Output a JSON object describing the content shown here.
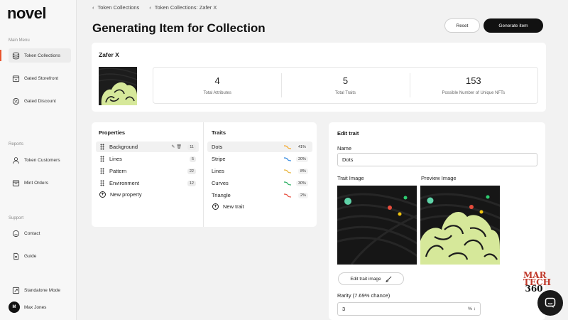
{
  "app": {
    "logo": "novel"
  },
  "sidebar": {
    "main_label": "Main Menu",
    "main_items": [
      {
        "label": "Token Collections",
        "icon": "database-icon",
        "active": true
      },
      {
        "label": "Gated Storefront",
        "icon": "storefront-icon"
      },
      {
        "label": "Gated Discount",
        "icon": "discount-icon"
      }
    ],
    "reports_label": "Reports",
    "reports_items": [
      {
        "label": "Token Customers",
        "icon": "user-icon"
      },
      {
        "label": "Mint Orders",
        "icon": "orders-icon"
      }
    ],
    "support_label": "Support",
    "support_items": [
      {
        "label": "Contact",
        "icon": "contact-icon"
      },
      {
        "label": "Guide",
        "icon": "guide-icon"
      }
    ],
    "standalone_label": "Standalone Mode",
    "user": {
      "initial": "M",
      "name": "Max Jones"
    }
  },
  "breadcrumbs": [
    "Token Collections",
    "Token Collections: Zafer X"
  ],
  "header": {
    "title": "Generating Item for Collection",
    "reset_label": "Reset",
    "generate_label": "Generate item"
  },
  "collection": {
    "name": "Zafer X",
    "stats": [
      {
        "value": "4",
        "label": "Total Attributes"
      },
      {
        "value": "5",
        "label": "Total Traits"
      },
      {
        "value": "153",
        "label": "Possible Number of Unique NFTs"
      }
    ]
  },
  "properties": {
    "title": "Properties",
    "items": [
      {
        "name": "Background",
        "count": "11",
        "selected": true
      },
      {
        "name": "Lines",
        "count": "5"
      },
      {
        "name": "Pattern",
        "count": "22"
      },
      {
        "name": "Environment",
        "count": "12"
      }
    ],
    "add_label": "New property"
  },
  "traits": {
    "title": "Traits",
    "items": [
      {
        "name": "Dots",
        "percent": "41%",
        "color": "#f5a623",
        "selected": true
      },
      {
        "name": "Stripe",
        "percent": "20%",
        "color": "#2e86de"
      },
      {
        "name": "Lines",
        "percent": "8%",
        "color": "#e8b339"
      },
      {
        "name": "Curves",
        "percent": "30%",
        "color": "#27ae60"
      },
      {
        "name": "Triangle",
        "percent": "2%",
        "color": "#e74c3c"
      }
    ],
    "add_label": "New trait"
  },
  "edit_trait": {
    "title": "Edit trait",
    "name_label": "Name",
    "name_value": "Dots",
    "trait_image_label": "Trait Image",
    "preview_image_label": "Preview Image",
    "edit_image_label": "Edit trait image",
    "rarity_label": "Rarity (7.69% chance)",
    "rarity_value": "3",
    "rarity_unit": "%"
  },
  "watermark": {
    "line1": "MAR",
    "line2": "TECH",
    "line3": "360"
  },
  "colors": {
    "accent": "#e8542d",
    "primary": "#111111",
    "blob": "#d6e89a"
  }
}
